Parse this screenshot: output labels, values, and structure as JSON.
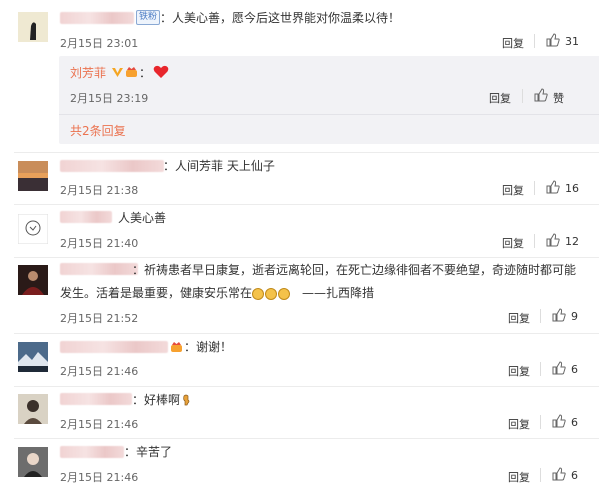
{
  "comments": [
    {
      "text": "：人美心善，愿今后这世界能对你温柔以待！",
      "badge": "铁粉",
      "date": "2月15日 23:01",
      "reply": "回复",
      "likes": "31"
    },
    {
      "text": "：人间芳菲 天上仙子",
      "date": "2月15日 21:38",
      "reply": "回复",
      "likes": "16"
    },
    {
      "text": "人美心善",
      "date": "2月15日 21:40",
      "reply": "回复",
      "likes": "12"
    },
    {
      "text_line1": "：祈祷患者早日康复，逝者远离轮回，在死亡边缘徘徊者不要绝望，奇迹随时都可能",
      "text_line2": "发生。活着是最重要，健康安乐常在",
      "text_tail": "——扎西降措",
      "date": "2月15日 21:52",
      "reply": "回复",
      "likes": "9"
    },
    {
      "text": "：谢谢！",
      "date": "2月15日 21:46",
      "reply": "回复",
      "likes": "6"
    },
    {
      "text": "：好棒啊",
      "date": "2月15日 21:46",
      "reply": "回复",
      "likes": "6"
    },
    {
      "text": "：辛苦了",
      "date": "2月15日 21:46",
      "reply": "回复",
      "likes": "6"
    }
  ],
  "sub_reply": {
    "author": "刘芳菲",
    "date": "2月15日 23:19",
    "reply": "回复",
    "like_label": "赞",
    "more": "共2条回复"
  },
  "colors": {
    "link": "#eb7350",
    "badge": "#4a7bc4"
  },
  "icons": {
    "like": "thumbs-up-icon",
    "heart": "heart-icon",
    "crown": "crown-icon",
    "verified": "verified-icon"
  }
}
